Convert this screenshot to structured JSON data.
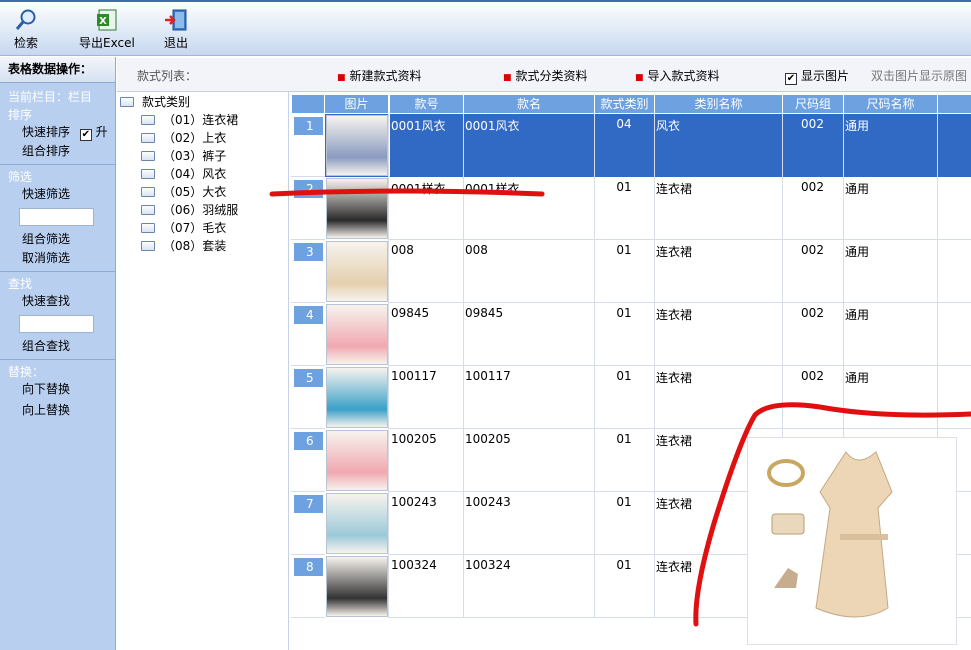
{
  "toolbar": {
    "search": "检索",
    "export": "导出Excel",
    "exit": "退出"
  },
  "left": {
    "header": "表格数据操作：",
    "current": "当前栏目：栏目",
    "sort_title": "排序",
    "quick_sort": "快速排序",
    "asc_label": "升",
    "combo_sort": "组合排序",
    "filter_title": "筛选",
    "quick_filter": "快速筛选",
    "combo_filter": "组合筛选",
    "cancel_filter": "取消筛选",
    "find_title": "查找",
    "quick_find": "快速查找",
    "combo_find": "组合查找",
    "replace_title": "替换：",
    "replace_down": "向下替换",
    "replace_up": "向上替换"
  },
  "listbar": {
    "title": "款式列表：",
    "new_style": "新建款式资料",
    "style_cat": "款式分类资料",
    "import_style": "导入款式资料",
    "show_image": "显示图片",
    "hint": "双击图片显示原图"
  },
  "tree": {
    "root": "款式类别",
    "items": [
      "（01）连衣裙",
      "（02）上衣",
      "（03）裤子",
      "（04）风衣",
      "（05）大衣",
      "（06）羽绒服",
      "（07）毛衣",
      "（08）套装"
    ]
  },
  "grid": {
    "columns": [
      "图片",
      "款号",
      "款名",
      "款式类别",
      "类别名称",
      "尺码组",
      "尺码名称"
    ],
    "rows": [
      {
        "n": "1",
        "code": "0001风衣",
        "name": "0001风衣",
        "cat": "04",
        "catname": "风衣",
        "sizegrp": "002",
        "sizename": "通用"
      },
      {
        "n": "2",
        "code": "0001样衣",
        "name": "0001样衣",
        "cat": "01",
        "catname": "连衣裙",
        "sizegrp": "002",
        "sizename": "通用"
      },
      {
        "n": "3",
        "code": "008",
        "name": "008",
        "cat": "01",
        "catname": "连衣裙",
        "sizegrp": "002",
        "sizename": "通用"
      },
      {
        "n": "4",
        "code": "09845",
        "name": "09845",
        "cat": "01",
        "catname": "连衣裙",
        "sizegrp": "002",
        "sizename": "通用"
      },
      {
        "n": "5",
        "code": "100117",
        "name": "100117",
        "cat": "01",
        "catname": "连衣裙",
        "sizegrp": "002",
        "sizename": "通用"
      },
      {
        "n": "6",
        "code": "100205",
        "name": "100205",
        "cat": "01",
        "catname": "连衣裙",
        "sizegrp": "",
        "sizename": ""
      },
      {
        "n": "7",
        "code": "100243",
        "name": "100243",
        "cat": "01",
        "catname": "连衣裙",
        "sizegrp": "",
        "sizename": ""
      },
      {
        "n": "8",
        "code": "100324",
        "name": "100324",
        "cat": "01",
        "catname": "连衣裙",
        "sizegrp": "",
        "sizename": ""
      }
    ]
  },
  "colors": {
    "accent": "#316ac5",
    "header": "#6da1e0",
    "sidebar": "#b9cff0",
    "annotation": "#e01010"
  }
}
